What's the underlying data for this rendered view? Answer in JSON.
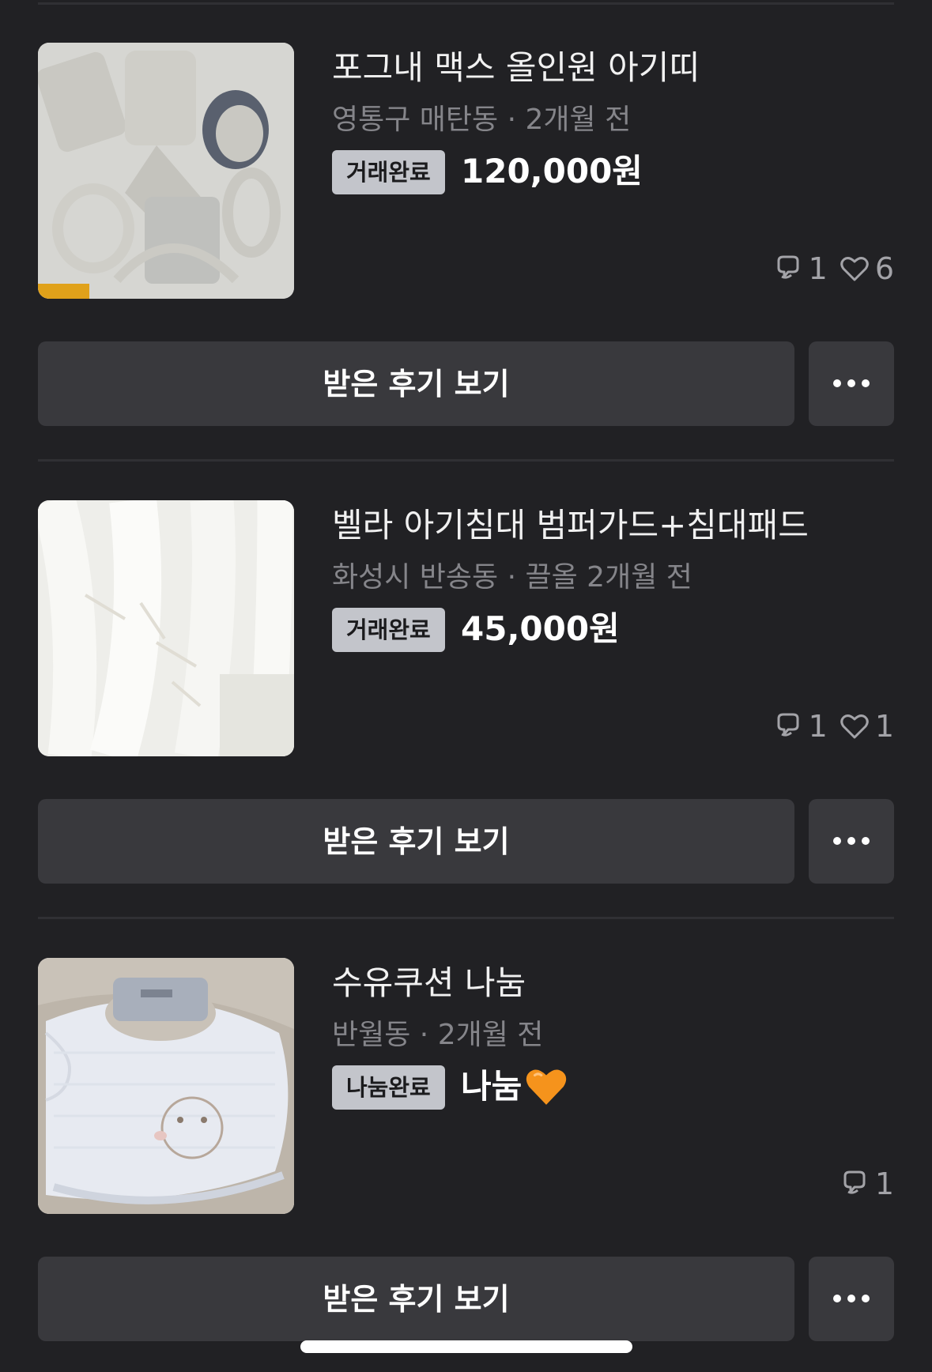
{
  "items": [
    {
      "title": "포그내 맥스 올인원 아기띠",
      "meta": "영통구 매탄동 · 2개월 전",
      "status": "거래완료",
      "price": "120,000원",
      "comments": "1",
      "likes": "6",
      "review_label": "받은 후기 보기"
    },
    {
      "title": "벨라 아기침대 범퍼가드+침대패드",
      "meta": "화성시 반송동 · 끌올 2개월 전",
      "status": "거래완료",
      "price": "45,000원",
      "comments": "1",
      "likes": "1",
      "review_label": "받은 후기 보기"
    },
    {
      "title": "수유쿠션 나눔",
      "meta": "반월동 · 2개월 전",
      "status": "나눔완료",
      "price": "나눔",
      "price_emoji": "orange-heart-icon",
      "comments": "1",
      "review_label": "받은 후기 보기"
    }
  ],
  "colors": {
    "background": "#212124",
    "button": "#39393d",
    "badge": "#c3c5cb",
    "meta_text": "#85858a",
    "orange_heart": "#f5931c"
  }
}
